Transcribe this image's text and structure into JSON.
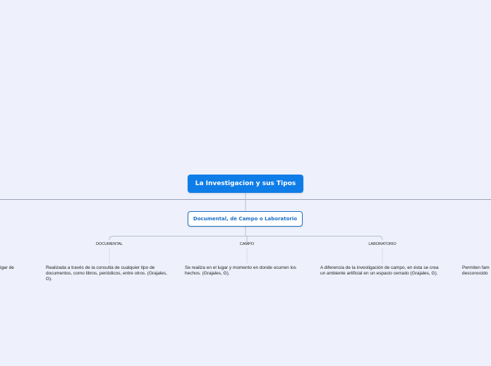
{
  "map": {
    "root": "La Investigacion y sus Tipos",
    "main": "Documental, de Campo o Laboratorio",
    "branches": [
      {
        "label": "DOCUMENTAL",
        "text": "Realizada a través de la consulta de cualquier tipo de documentos, como libros, periódicos, entre otros. (Grajales, G)."
      },
      {
        "label": "CAMPO",
        "text": "Se realiza en el lugar y momento en donde ocurren los hechos. (Grajales, G)."
      },
      {
        "label": "LABORATORIO",
        "text": "A diferencia de la investigación de campo, en ésta se crea un ambiente artificial en un espacio cerrado (Grajales, G)."
      }
    ],
    "left_clip": "igar de",
    "right_clip": [
      "Permiten fam",
      "desconocido"
    ]
  },
  "colors": {
    "background": "#eef1fb",
    "root_fill": "#0f7de8",
    "main_border": "#1a6fc9",
    "connector": "#b8bdcc"
  }
}
